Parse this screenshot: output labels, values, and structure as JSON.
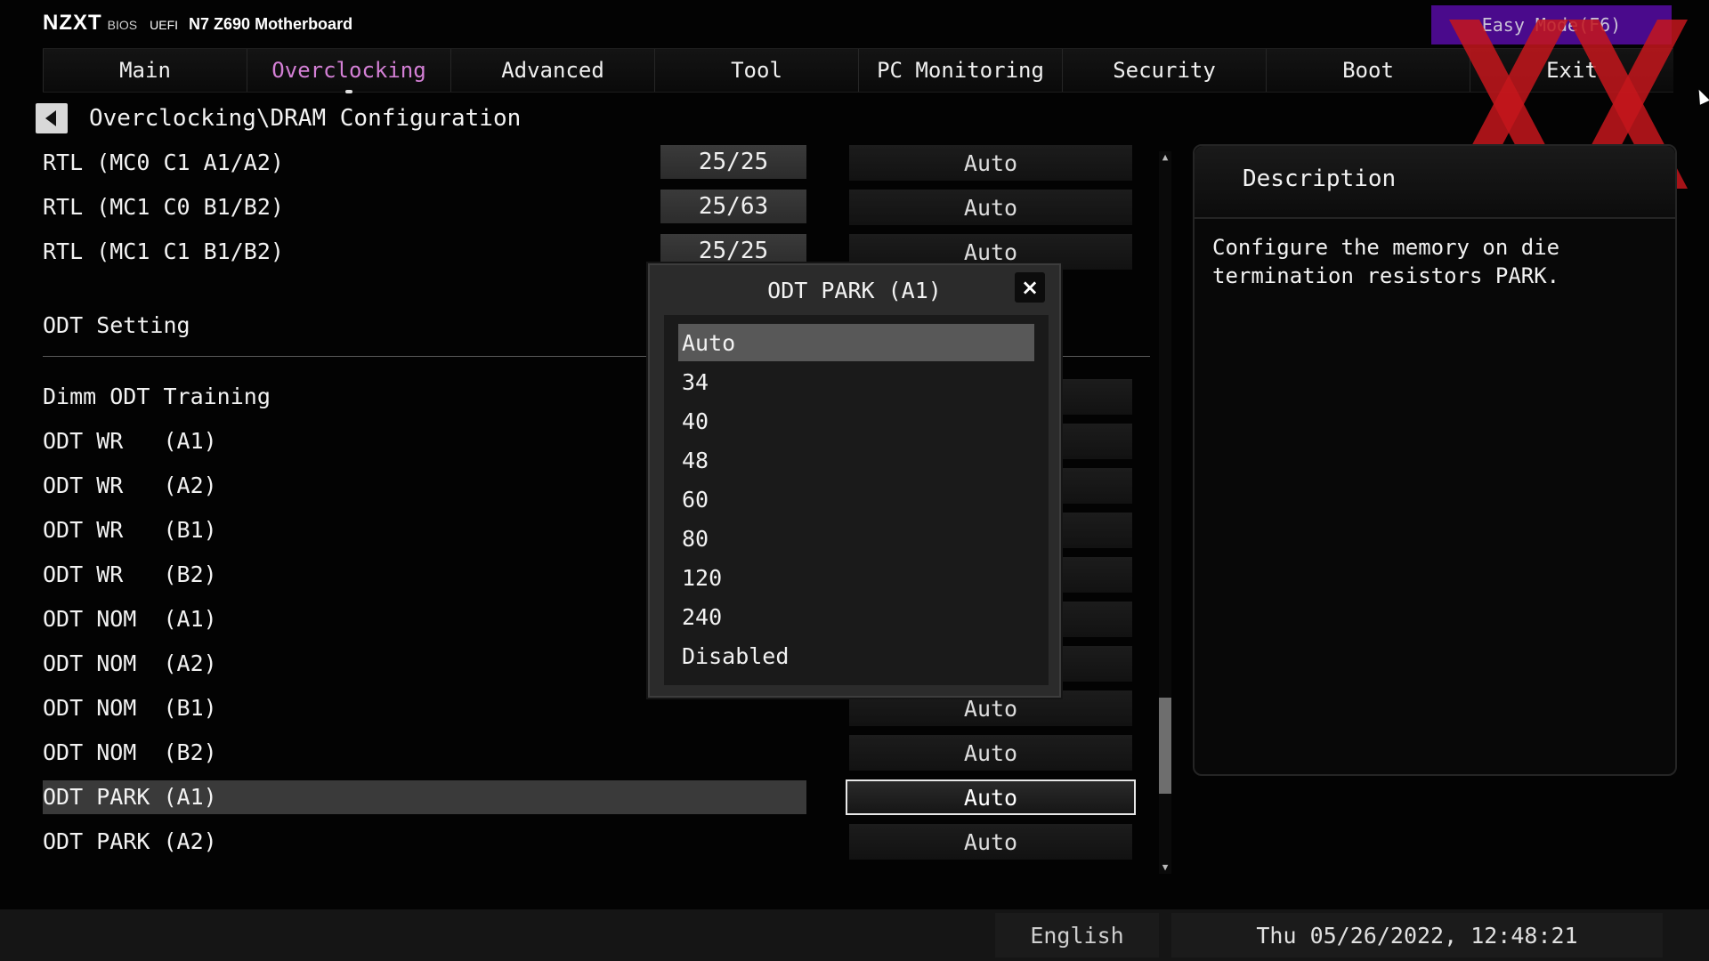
{
  "header": {
    "brand": "NZXT",
    "bios": "BIOS",
    "uefi": "UEFI",
    "model": "N7 Z690 Motherboard",
    "easy_mode": "Easy Mode(F6)"
  },
  "tabs": [
    {
      "label": "Main",
      "active": false
    },
    {
      "label": "Overclocking",
      "active": true
    },
    {
      "label": "Advanced",
      "active": false
    },
    {
      "label": "Tool",
      "active": false
    },
    {
      "label": "PC Monitoring",
      "active": false
    },
    {
      "label": "Security",
      "active": false
    },
    {
      "label": "Boot",
      "active": false
    },
    {
      "label": "Exit",
      "active": false
    }
  ],
  "breadcrumb": "Overclocking\\DRAM Configuration",
  "rtl_rows": [
    {
      "label": "RTL (MC0 C1 A1/A2)",
      "current": "25/25",
      "value": "Auto"
    },
    {
      "label": "RTL (MC1 C0 B1/B2)",
      "current": "25/63",
      "value": "Auto"
    },
    {
      "label": "RTL (MC1 C1 B1/B2)",
      "current": "25/25",
      "value": "Auto"
    }
  ],
  "section": "ODT Setting",
  "odt_rows": [
    {
      "label": "Dimm ODT Training",
      "value": ""
    },
    {
      "label": "ODT WR   (A1)",
      "value": ""
    },
    {
      "label": "ODT WR   (A2)",
      "value": ""
    },
    {
      "label": "ODT WR   (B1)",
      "value": ""
    },
    {
      "label": "ODT WR   (B2)",
      "value": ""
    },
    {
      "label": "ODT NOM  (A1)",
      "value": ""
    },
    {
      "label": "ODT NOM  (A2)",
      "value": ""
    },
    {
      "label": "ODT NOM  (B1)",
      "value": "Auto"
    },
    {
      "label": "ODT NOM  (B2)",
      "value": "Auto"
    },
    {
      "label": "ODT PARK (A1)",
      "value": "Auto",
      "selected": true
    },
    {
      "label": "ODT PARK (A2)",
      "value": "Auto"
    }
  ],
  "description": {
    "title": "Description",
    "text": "Configure the memory on die termination resistors PARK."
  },
  "popup": {
    "title": "ODT PARK (A1)",
    "close_icon": "×",
    "options": [
      "Auto",
      "34",
      "40",
      "48",
      "60",
      "80",
      "120",
      "240",
      "Disabled"
    ],
    "selected": "Auto"
  },
  "footer": {
    "language": "English",
    "datetime": "Thu 05/26/2022, 12:48:21"
  },
  "colors": {
    "accent_tab": "#d480d6",
    "easy_mode_bg": "#4a0a8c",
    "watermark": "#c4161c"
  }
}
